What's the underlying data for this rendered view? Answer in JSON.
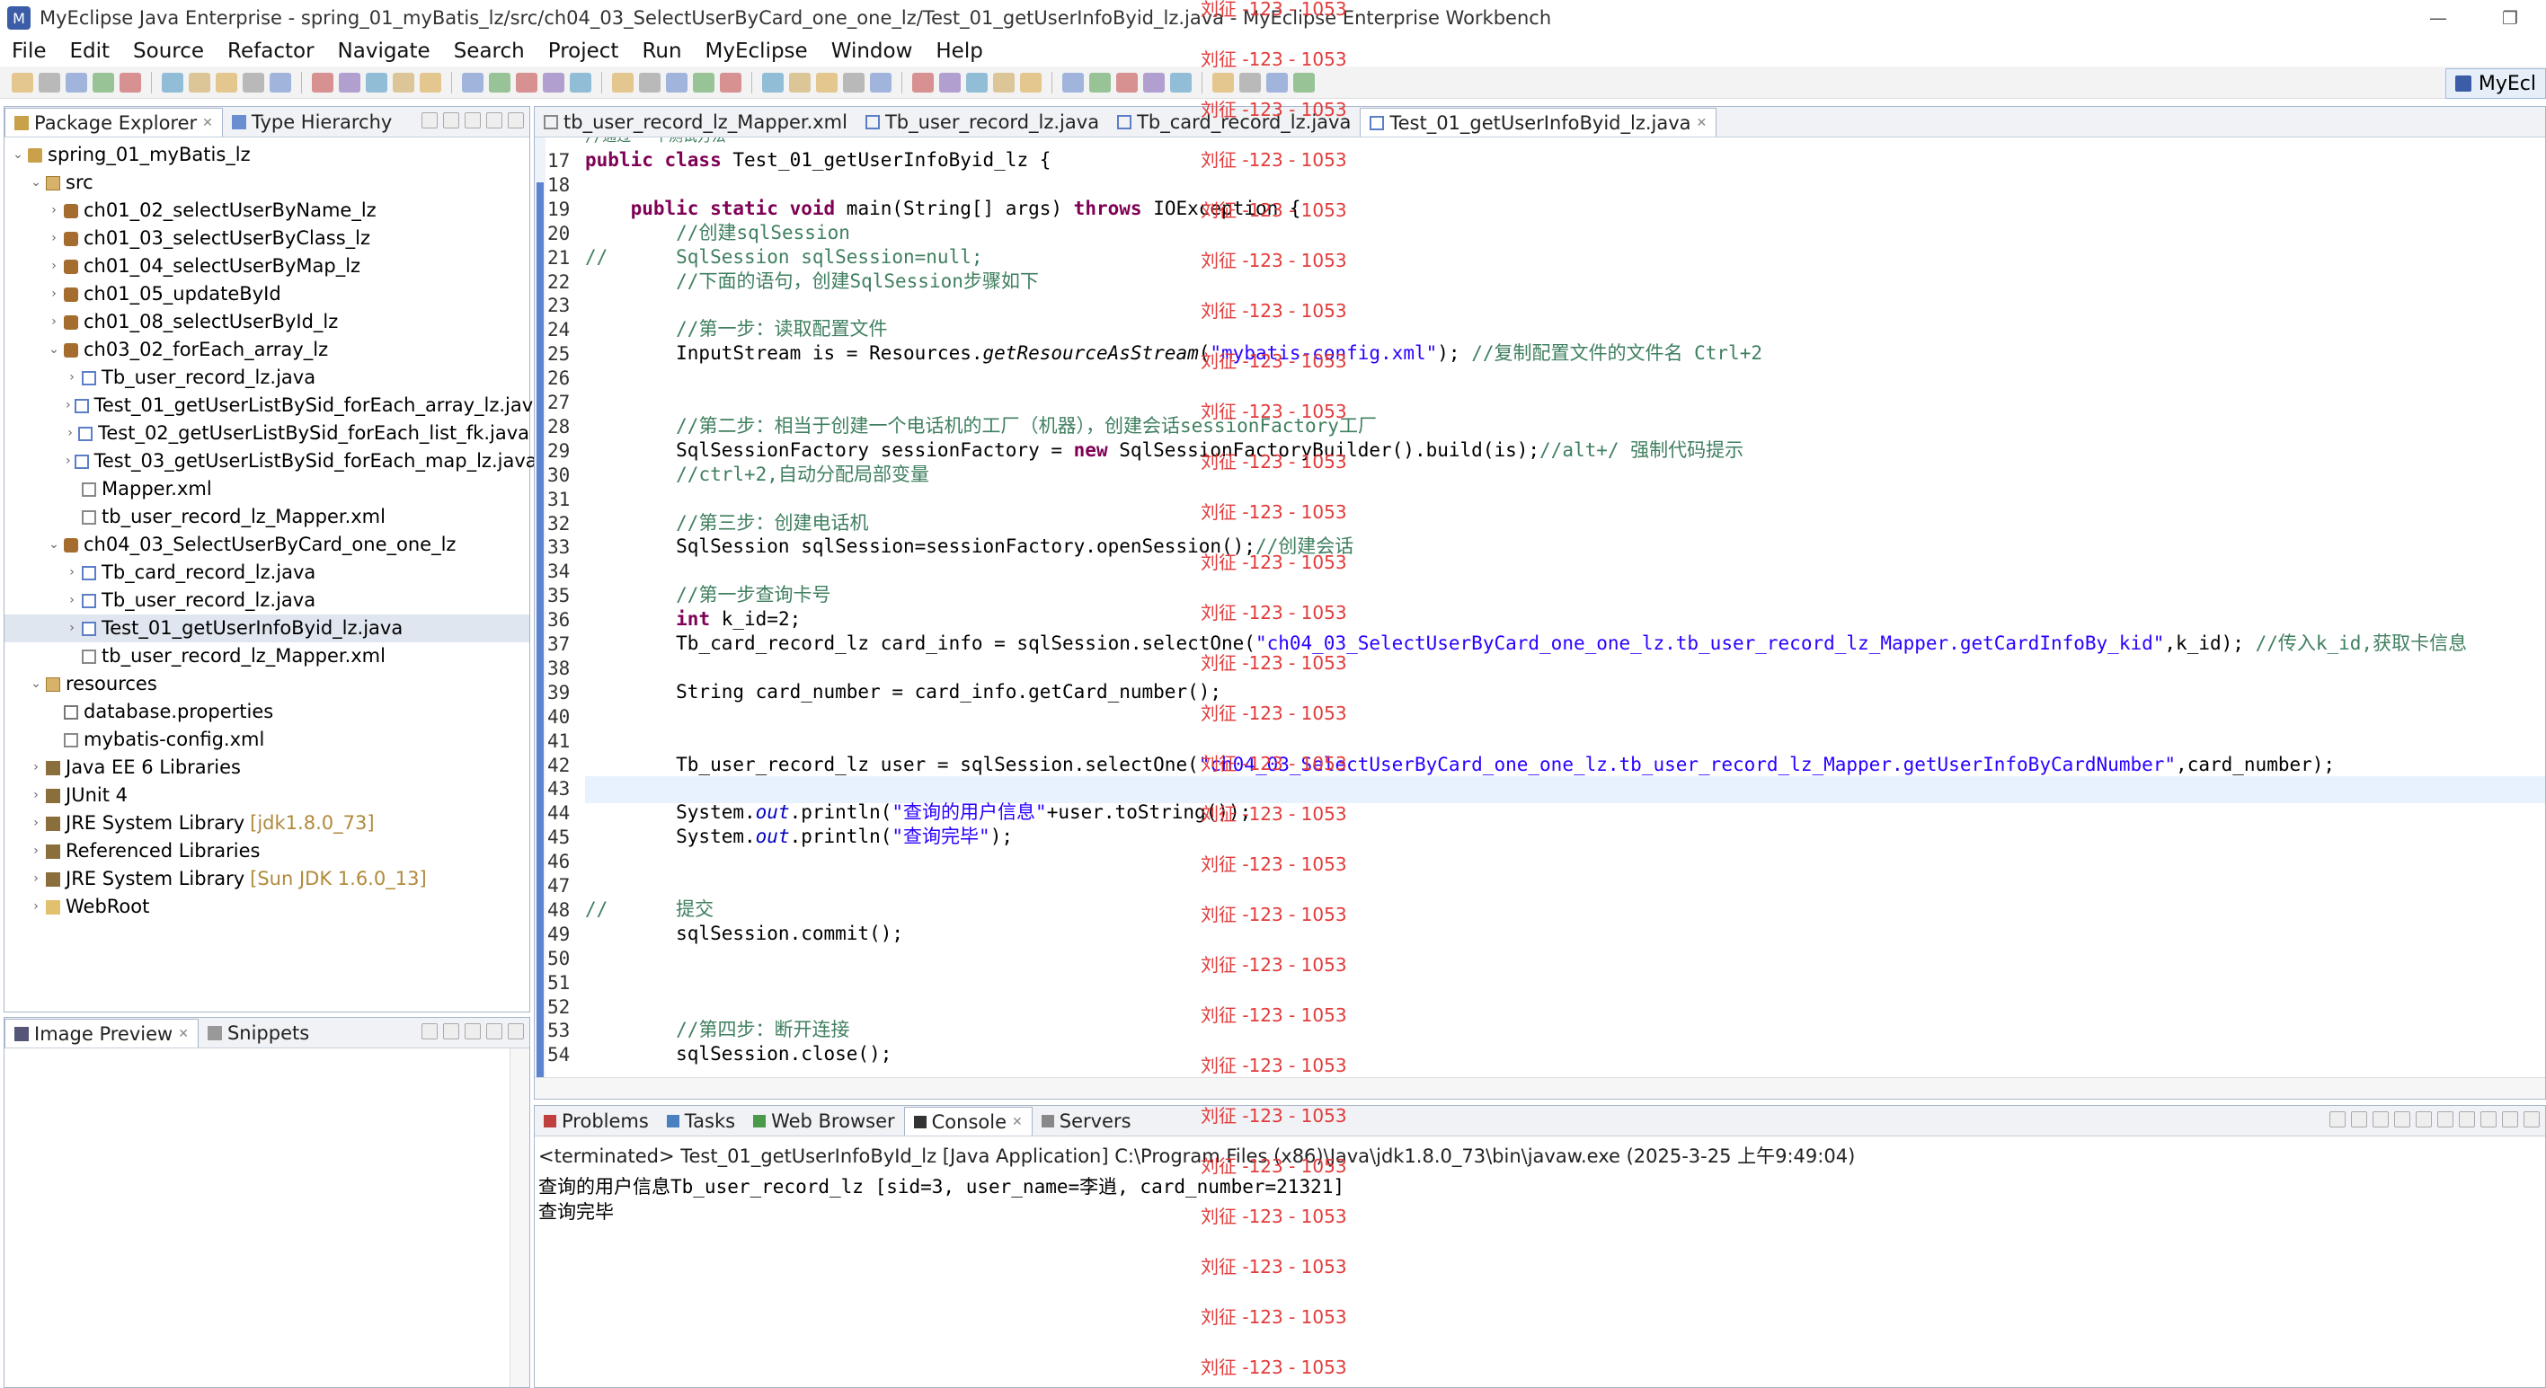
{
  "window": {
    "title": "MyEclipse Java Enterprise - spring_01_myBatis_lz/src/ch04_03_SelectUserByCard_one_one_lz/Test_01_getUserInfoByid_lz.java - MyEclipse Enterprise Workbench",
    "minimize": "—",
    "maximize": "❐"
  },
  "menu": [
    "File",
    "Edit",
    "Source",
    "Refactor",
    "Navigate",
    "Search",
    "Project",
    "Run",
    "MyEclipse",
    "Window",
    "Help"
  ],
  "perspective": "MyEcl",
  "explorer": {
    "tabs": [
      "Package Explorer",
      "Type Hierarchy"
    ],
    "tree": [
      {
        "label": "spring_01_myBatis_lz",
        "indent": 0,
        "tw": "v",
        "icon": "proj"
      },
      {
        "label": "src",
        "indent": 1,
        "tw": "v",
        "icon": "src"
      },
      {
        "label": "ch01_02_selectUserByName_lz",
        "indent": 2,
        "tw": ">",
        "icon": "pkg"
      },
      {
        "label": "ch01_03_selectUserByClass_lz",
        "indent": 2,
        "tw": ">",
        "icon": "pkg"
      },
      {
        "label": "ch01_04_selectUserByMap_lz",
        "indent": 2,
        "tw": ">",
        "icon": "pkg"
      },
      {
        "label": "ch01_05_updateById",
        "indent": 2,
        "tw": ">",
        "icon": "pkg"
      },
      {
        "label": "ch01_08_selectUserById_lz",
        "indent": 2,
        "tw": ">",
        "icon": "pkg"
      },
      {
        "label": "ch03_02_forEach_array_lz",
        "indent": 2,
        "tw": "v",
        "icon": "pkg"
      },
      {
        "label": "Tb_user_record_lz.java",
        "indent": 3,
        "tw": ">",
        "icon": "java"
      },
      {
        "label": "Test_01_getUserListBySid_forEach_array_lz.java",
        "indent": 3,
        "tw": ">",
        "icon": "java"
      },
      {
        "label": "Test_02_getUserListBySid_forEach_list_fk.java",
        "indent": 3,
        "tw": ">",
        "icon": "java"
      },
      {
        "label": "Test_03_getUserListBySid_forEach_map_lz.java",
        "indent": 3,
        "tw": ">",
        "icon": "java"
      },
      {
        "label": "Mapper.xml",
        "indent": 3,
        "tw": "",
        "icon": "xml"
      },
      {
        "label": "tb_user_record_lz_Mapper.xml",
        "indent": 3,
        "tw": "",
        "icon": "xml"
      },
      {
        "label": "ch04_03_SelectUserByCard_one_one_lz",
        "indent": 2,
        "tw": "v",
        "icon": "pkg"
      },
      {
        "label": "Tb_card_record_lz.java",
        "indent": 3,
        "tw": ">",
        "icon": "java"
      },
      {
        "label": "Tb_user_record_lz.java",
        "indent": 3,
        "tw": ">",
        "icon": "java"
      },
      {
        "label": "Test_01_getUserInfoByid_lz.java",
        "indent": 3,
        "tw": ">",
        "icon": "java",
        "sel": true
      },
      {
        "label": "tb_user_record_lz_Mapper.xml",
        "indent": 3,
        "tw": "",
        "icon": "xml"
      },
      {
        "label": "resources",
        "indent": 1,
        "tw": "v",
        "icon": "src"
      },
      {
        "label": "database.properties",
        "indent": 2,
        "tw": "",
        "icon": "prop"
      },
      {
        "label": "mybatis-config.xml",
        "indent": 2,
        "tw": "",
        "icon": "xml"
      },
      {
        "label": "Java EE 6 Libraries",
        "indent": 1,
        "tw": ">",
        "icon": "lib"
      },
      {
        "label": "JUnit 4",
        "indent": 1,
        "tw": ">",
        "icon": "lib"
      },
      {
        "label": "JRE System Library",
        "suffix": "[jdk1.8.0_73]",
        "indent": 1,
        "tw": ">",
        "icon": "lib"
      },
      {
        "label": "Referenced Libraries",
        "indent": 1,
        "tw": ">",
        "icon": "lib"
      },
      {
        "label": "JRE System Library",
        "suffix": "[Sun JDK 1.6.0_13]",
        "indent": 1,
        "tw": ">",
        "icon": "lib"
      },
      {
        "label": "WebRoot",
        "indent": 1,
        "tw": ">",
        "icon": "folder"
      }
    ]
  },
  "preview": {
    "tabs": [
      "Image Preview",
      "Snippets"
    ]
  },
  "editor": {
    "tabs": [
      "tb_user_record_lz_Mapper.xml",
      "Tb_user_record_lz.java",
      "Tb_card_record_lz.java",
      "Test_01_getUserInfoByid_lz.java"
    ],
    "partial_top": "//通过 一个测试方法",
    "lines": [
      {
        "n": "17",
        "segs": [
          [
            "kw",
            "public class "
          ],
          [
            "",
            "Test_01_getUserInfoByid_lz {"
          ]
        ]
      },
      {
        "n": "18",
        "segs": []
      },
      {
        "n": "19",
        "segs": [
          [
            "",
            "    "
          ],
          [
            "kw",
            "public static void "
          ],
          [
            "",
            "main(String[] args) "
          ],
          [
            "kw",
            "throws "
          ],
          [
            "",
            "IOException {"
          ]
        ]
      },
      {
        "n": "20",
        "segs": [
          [
            "",
            "        "
          ],
          [
            "cm",
            "//创建sqlSession"
          ]
        ]
      },
      {
        "n": "21",
        "segs": [
          [
            "cm",
            "//      SqlSession sqlSession=null;"
          ]
        ]
      },
      {
        "n": "22",
        "segs": [
          [
            "",
            "        "
          ],
          [
            "cm",
            "//下面的语句，创建SqlSession步骤如下"
          ]
        ]
      },
      {
        "n": "23",
        "segs": []
      },
      {
        "n": "24",
        "segs": [
          [
            "",
            "        "
          ],
          [
            "cm",
            "//第一步：读取配置文件"
          ]
        ]
      },
      {
        "n": "25",
        "segs": [
          [
            "",
            "        InputStream is = Resources."
          ],
          [
            "it",
            "getResourceAsStream"
          ],
          [
            "",
            "("
          ],
          [
            "st",
            "\"mybatis-config.xml\""
          ],
          [
            "",
            "); "
          ],
          [
            "cm",
            "//复制配置文件的文件名 Ctrl+2"
          ]
        ]
      },
      {
        "n": "26",
        "segs": []
      },
      {
        "n": "27",
        "segs": []
      },
      {
        "n": "28",
        "segs": [
          [
            "",
            "        "
          ],
          [
            "cm",
            "//第二步：相当于创建一个电话机的工厂（机器），创建会话sessionFactory工厂"
          ]
        ]
      },
      {
        "n": "29",
        "segs": [
          [
            "",
            "        SqlSessionFactory sessionFactory = "
          ],
          [
            "kw",
            "new "
          ],
          [
            "",
            "SqlSessionFactoryBuilder().build(is);"
          ],
          [
            "cm",
            "//alt+/ 强制代码提示"
          ]
        ]
      },
      {
        "n": "30",
        "segs": [
          [
            "",
            "        "
          ],
          [
            "cm",
            "//ctrl+2,自动分配局部变量"
          ]
        ]
      },
      {
        "n": "31",
        "segs": []
      },
      {
        "n": "32",
        "segs": [
          [
            "",
            "        "
          ],
          [
            "cm",
            "//第三步：创建电话机"
          ]
        ]
      },
      {
        "n": "33",
        "segs": [
          [
            "",
            "        SqlSession sqlSession=sessionFactory.openSession();"
          ],
          [
            "cm",
            "//创建会话"
          ]
        ]
      },
      {
        "n": "34",
        "segs": []
      },
      {
        "n": "35",
        "segs": [
          [
            "",
            "        "
          ],
          [
            "cm",
            "//第一步查询卡号"
          ]
        ]
      },
      {
        "n": "36",
        "segs": [
          [
            "",
            "        "
          ],
          [
            "kw",
            "int "
          ],
          [
            "",
            "k_id=2;"
          ]
        ]
      },
      {
        "n": "37",
        "segs": [
          [
            "",
            "        Tb_card_record_lz card_info = sqlSession.selectOne("
          ],
          [
            "st",
            "\"ch04_03_SelectUserByCard_one_one_lz.tb_user_record_lz_Mapper.getCardInfoBy_kid\""
          ],
          [
            "",
            ",k_id); "
          ],
          [
            "cm",
            "//传入k_id,获取卡信息"
          ]
        ]
      },
      {
        "n": "38",
        "segs": []
      },
      {
        "n": "39",
        "segs": [
          [
            "",
            "        String card_number = card_info.getCard_number();"
          ]
        ]
      },
      {
        "n": "40",
        "segs": []
      },
      {
        "n": "41",
        "segs": []
      },
      {
        "n": "42",
        "segs": [
          [
            "",
            "        Tb_user_record_lz user = sqlSession.selectOne("
          ],
          [
            "st",
            "\"ch04_03_SelectUserByCard_one_one_lz.tb_user_record_lz_Mapper.getUserInfoByCardNumber\""
          ],
          [
            "",
            ",card_number);"
          ]
        ]
      },
      {
        "n": "43",
        "segs": []
      },
      {
        "n": "44",
        "segs": [
          [
            "",
            "        System."
          ],
          [
            "sfi",
            "out"
          ],
          [
            "",
            ".println("
          ],
          [
            "st",
            "\"查询的用户信息\""
          ],
          [
            "",
            "+user.toString());"
          ]
        ]
      },
      {
        "n": "45",
        "segs": [
          [
            "",
            "        System."
          ],
          [
            "sfi",
            "out"
          ],
          [
            "",
            ".println("
          ],
          [
            "st",
            "\"查询完毕\""
          ],
          [
            "",
            ");"
          ]
        ]
      },
      {
        "n": "46",
        "segs": []
      },
      {
        "n": "47",
        "segs": []
      },
      {
        "n": "48",
        "segs": [
          [
            "cm",
            "//      提交"
          ]
        ]
      },
      {
        "n": "49",
        "segs": [
          [
            "",
            "        sqlSession.commit();"
          ]
        ]
      },
      {
        "n": "50",
        "segs": []
      },
      {
        "n": "51",
        "segs": []
      },
      {
        "n": "52",
        "segs": []
      },
      {
        "n": "53",
        "segs": [
          [
            "",
            "        "
          ],
          [
            "cm",
            "//第四步：断开连接"
          ]
        ]
      },
      {
        "n": "54",
        "segs": [
          [
            "",
            "        sqlSession.close();"
          ]
        ]
      }
    ]
  },
  "console": {
    "tabs": [
      "Problems",
      "Tasks",
      "Web Browser",
      "Console",
      "Servers"
    ],
    "header": "<terminated> Test_01_getUserInfoById_lz [Java Application] C:\\Program Files (x86)\\Java\\jdk1.8.0_73\\bin\\javaw.exe (2025-3-25 上午9:49:04)",
    "lines": [
      "查询的用户信息Tb_user_record_lz [sid=3, user_name=李逍, card_number=21321]",
      "查询完毕"
    ]
  },
  "watermark": {
    "text": "刘征 -123 - 1053",
    "color": "#e23b3b"
  }
}
